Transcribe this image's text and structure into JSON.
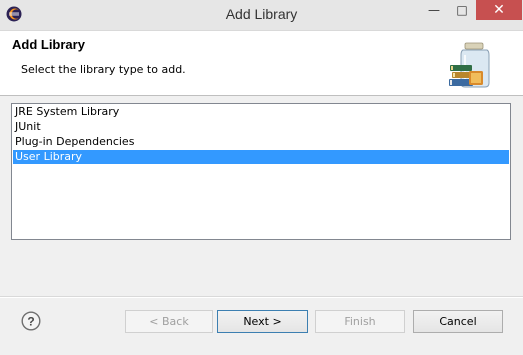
{
  "window": {
    "title": "Add Library",
    "minimize_glyph": "—",
    "maximize_glyph": "□",
    "close_glyph": "✕"
  },
  "banner": {
    "title": "Add Library",
    "description": "Select the library type to add."
  },
  "library_types": [
    {
      "label": "JRE System Library",
      "selected": false
    },
    {
      "label": "JUnit",
      "selected": false
    },
    {
      "label": "Plug-in Dependencies",
      "selected": false
    },
    {
      "label": "User Library",
      "selected": true
    }
  ],
  "buttons": {
    "back": {
      "label": "< Back",
      "enabled": false
    },
    "next": {
      "label": "Next >",
      "enabled": true
    },
    "finish": {
      "label": "Finish",
      "enabled": false
    },
    "cancel": {
      "label": "Cancel",
      "enabled": true
    }
  },
  "icons": {
    "app": "eclipse-icon",
    "banner": "library-jar-icon",
    "help": "help-icon"
  },
  "colors": {
    "selection": "#3399ff",
    "close_button": "#c75050"
  }
}
